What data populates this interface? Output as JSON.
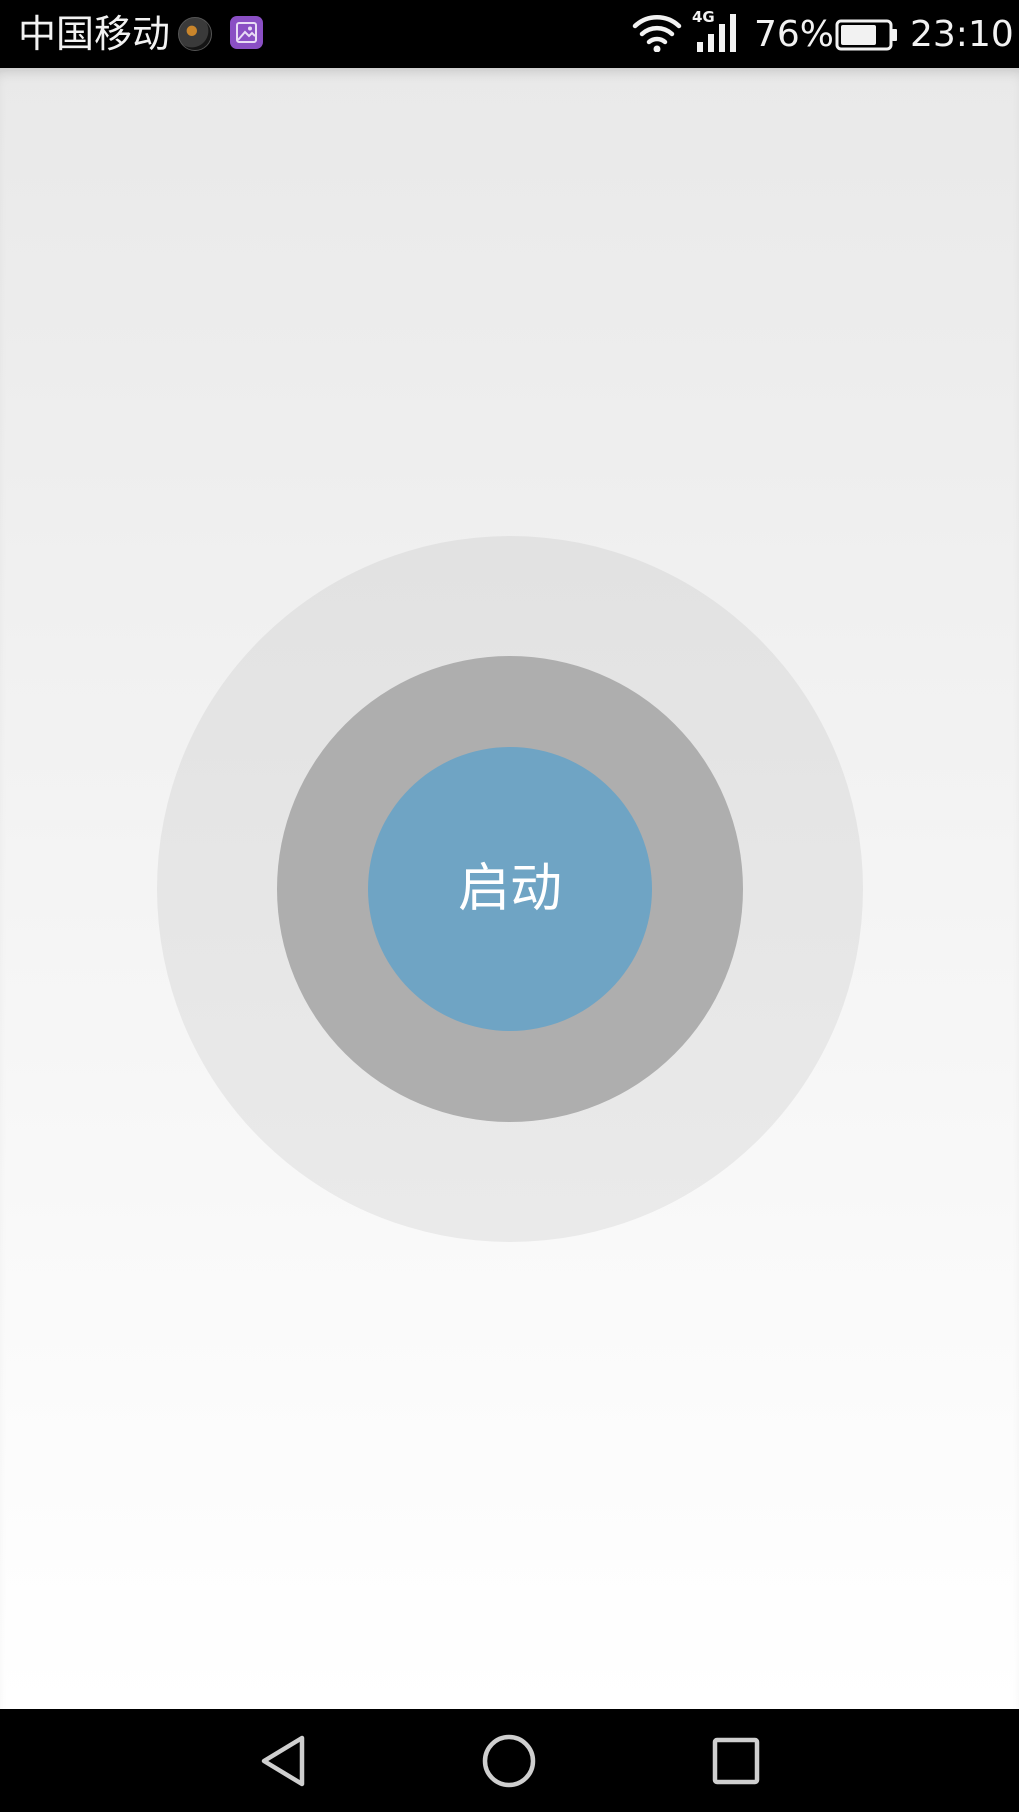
{
  "status_bar": {
    "carrier": "中国移动",
    "network_type": "4G",
    "battery_percent": "76%",
    "battery_level": 0.76,
    "time": "23:10",
    "notification_icons": [
      "app-notification-icon",
      "gallery-notification-icon"
    ]
  },
  "main": {
    "start_button_label": "启动"
  },
  "nav_bar": {
    "buttons": [
      "back-icon",
      "home-icon",
      "recent-apps-icon"
    ]
  },
  "colors": {
    "start_button": "#6fa4c4",
    "middle_ring": "#aeaeae",
    "outer_ring": "#e4e4e4",
    "gallery_icon_bg": "#8a4fc4"
  }
}
